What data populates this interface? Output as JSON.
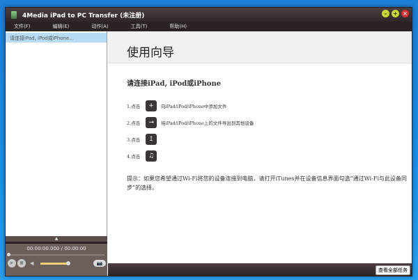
{
  "window": {
    "title": "4Media iPad to PC Transfer (未注册)"
  },
  "menu": [
    "文件(F)",
    "编辑(E)",
    "动作(A)",
    "工具(T)",
    "帮助(H)"
  ],
  "sidebar": {
    "device_item": "请连接iPad, iPod或iPhone..."
  },
  "player": {
    "time": "00:00:00.000 / 00:00:00",
    "volume_percent": 100,
    "seek_percent": 0
  },
  "main": {
    "title": "使用向导",
    "connect_heading": "请连接iPad, iPod或iPhone",
    "steps": [
      {
        "num": "1.点击",
        "icon": "add-file-icon",
        "text": "向iPad/iPod/iPhone中添加文件"
      },
      {
        "num": "2.点击",
        "icon": "export-icon",
        "text": "将iPad/iPod/iPhone上的文件导出到其他设备"
      },
      {
        "num": "3.点击",
        "icon": "export-to-pc-icon",
        "text": ""
      },
      {
        "num": "4.点击",
        "icon": "itunes-icon",
        "text": ""
      }
    ],
    "tip": "提示：如果您希望通过Wi-Fi将您的设备连接到电脑，请打开iTunes并在设备信息界面勾选“通过Wi-Fi与此设备同步”的选择。",
    "view_all_tasks": "查看全部任务"
  }
}
